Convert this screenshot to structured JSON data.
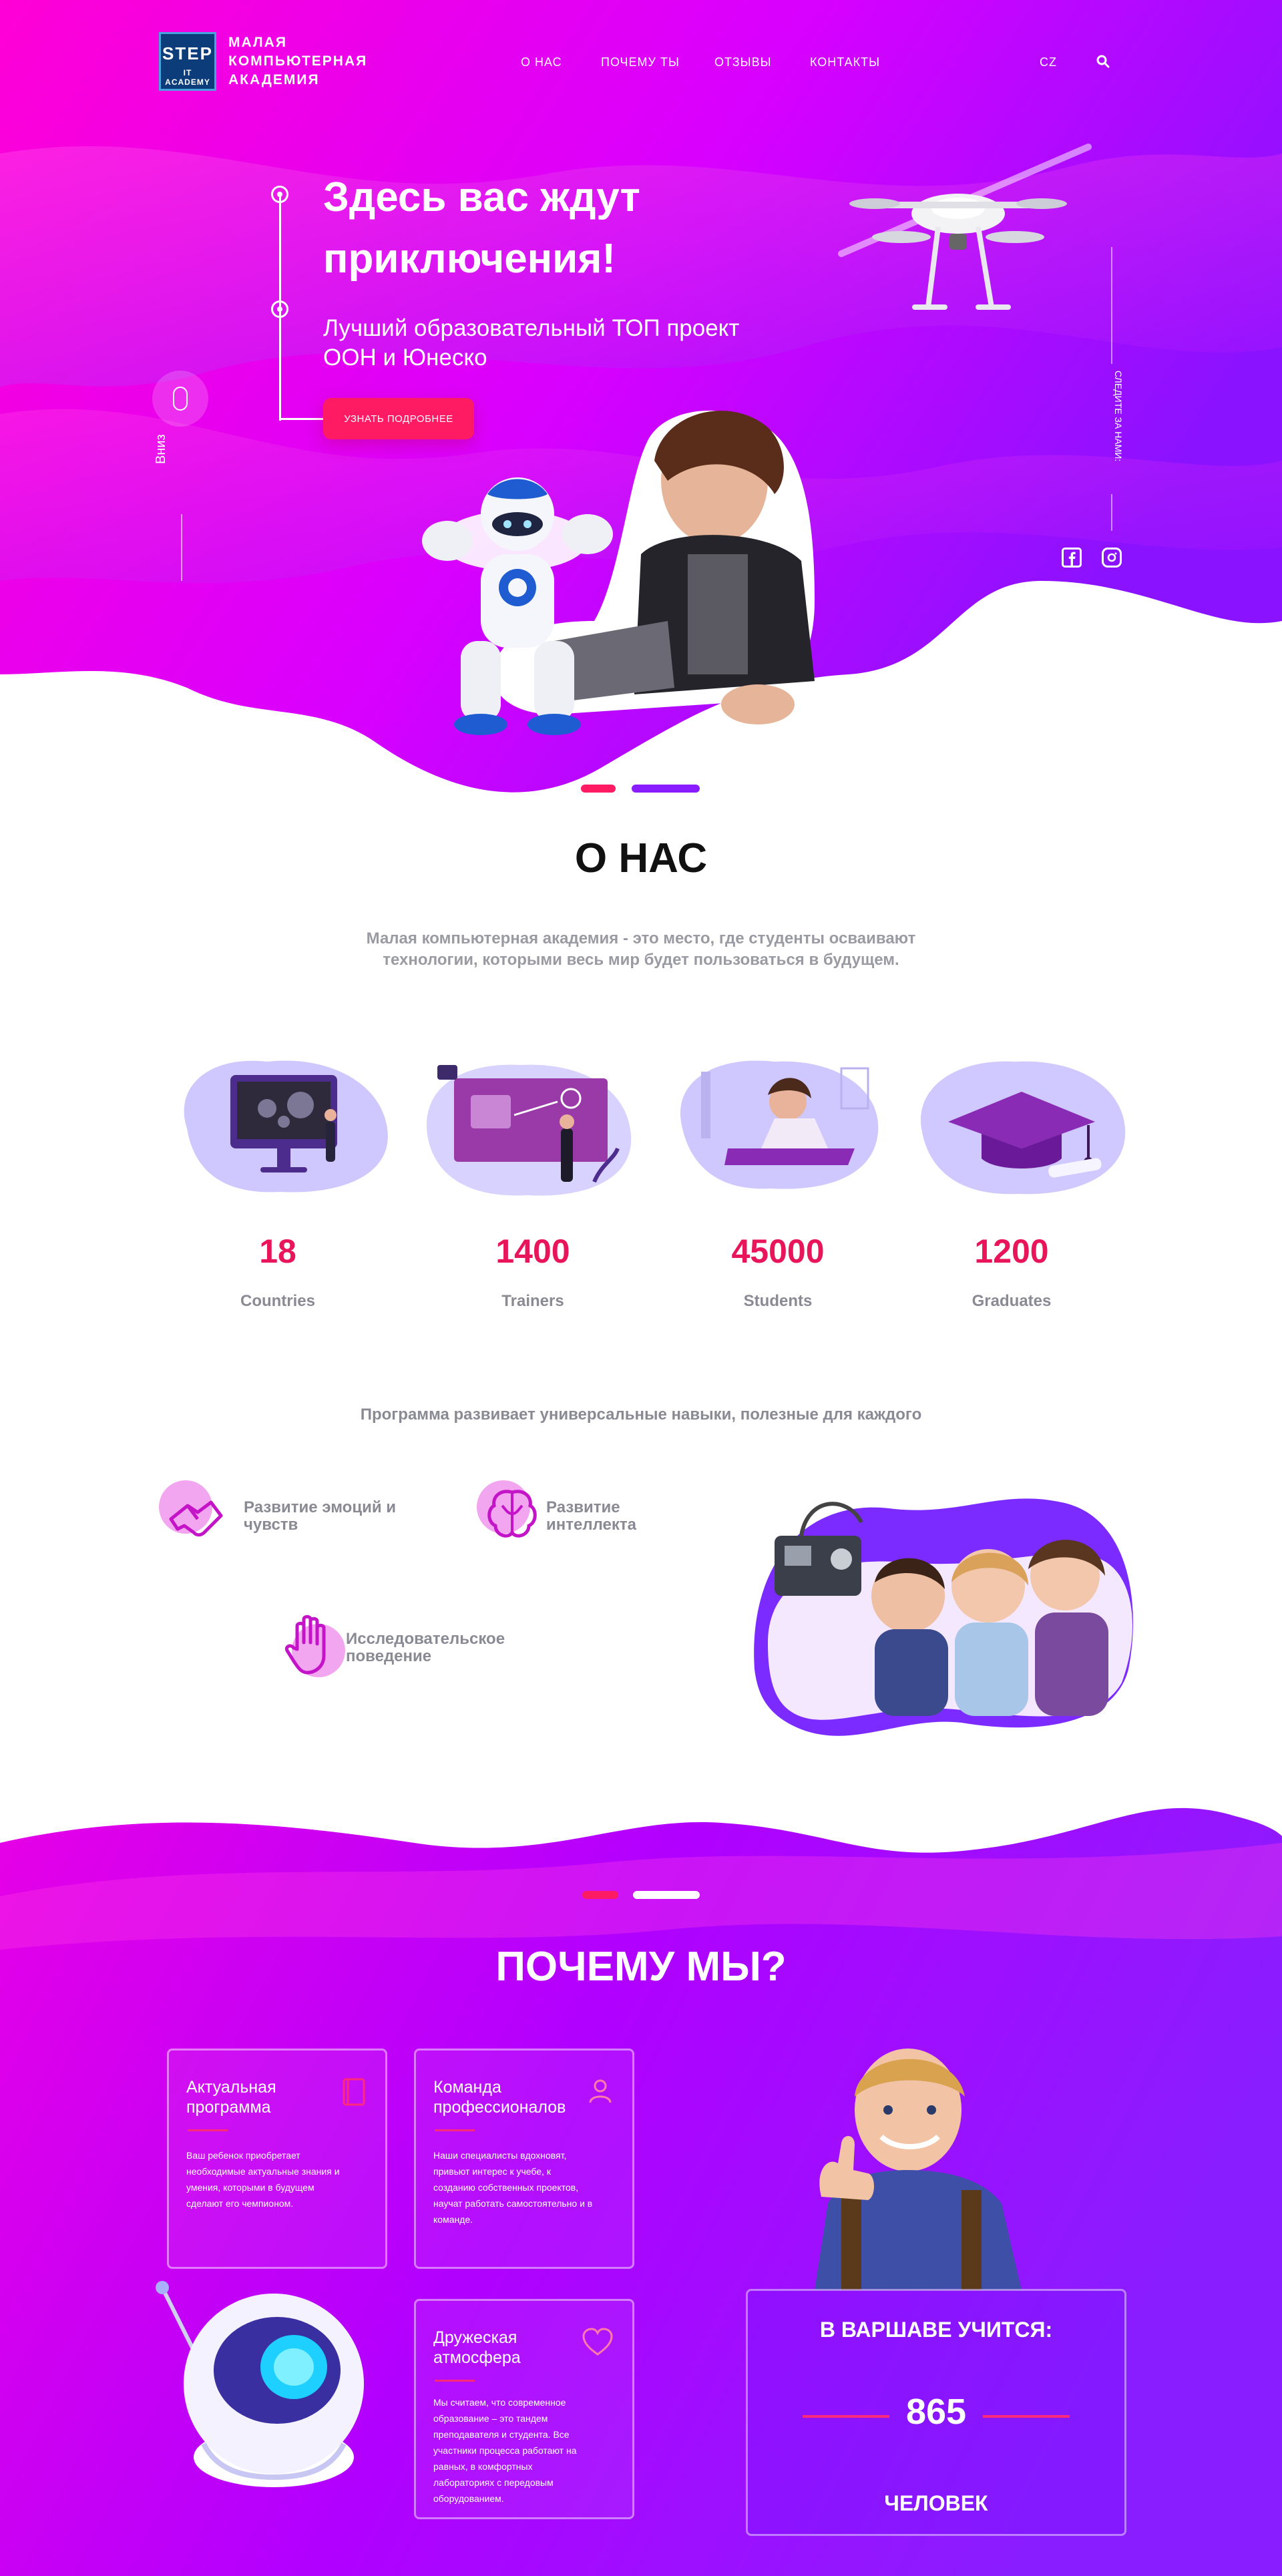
{
  "header": {
    "logo_step": "STEP",
    "logo_it": "IT ACADEMY",
    "brand_lines": [
      "МАЛАЯ",
      "КОМПЬЮТЕРНАЯ",
      "АКАДЕМИЯ"
    ],
    "nav": [
      "О НАС",
      "ПОЧЕМУ ТЫ",
      "ОТЗЫВЫ",
      "КОНТАКТЫ"
    ],
    "lang": "CZ"
  },
  "hero": {
    "title_lines": [
      "Здесь вас ждут",
      "приключения!"
    ],
    "subtitle_lines": [
      "Лучший образовательный ТОП проект",
      "ООН и Юнеско"
    ],
    "button": "УЗНАТЬ ПОДРОБНЕЕ",
    "scroll_label": "Вниз",
    "follow_label": "СЛЕДИТЕ ЗА НАМИ:"
  },
  "about": {
    "title": "О НАС",
    "desc_lines": [
      "Малая компьютерная академия - это место, где студенты осваивают",
      "технологии, которыми весь мир будет пользоваться в будущем."
    ],
    "stats": [
      {
        "value": "18",
        "label": "Countries"
      },
      {
        "value": "1400",
        "label": "Trainers"
      },
      {
        "value": "45000",
        "label": "Students"
      },
      {
        "value": "1200",
        "label": "Graduates"
      }
    ],
    "program_text": "Программа развивает универсальные навыки, полезные для каждого",
    "skills": [
      {
        "lines": [
          "Развитие эмоций и",
          "чувств"
        ],
        "icon": "handshake-icon"
      },
      {
        "lines": [
          "Развитие",
          "интеллекта"
        ],
        "icon": "brain-icon"
      },
      {
        "lines": [
          "Исследовательское",
          "поведение"
        ],
        "icon": "hand-icon"
      }
    ]
  },
  "why": {
    "title": "ПОЧЕМУ МЫ?",
    "cards": [
      {
        "title_lines": [
          "Актуальная",
          "программа"
        ],
        "text_lines": [
          "Ваш ребенок приобретает",
          "необходимые актуальные знания и",
          "умения, которыми в будущем",
          "сделают его чемпионом."
        ],
        "icon": "book-icon"
      },
      {
        "title_lines": [
          "Команда",
          "профессионалов"
        ],
        "text_lines": [
          "Наши специалисты вдохновят,",
          "привьют интерес к учебе, к",
          "созданию собственных проектов,",
          "научат работать самостоятельно и в",
          "команде."
        ],
        "icon": "user-icon"
      },
      {
        "title_lines": [
          "Дружеская",
          "атмосфера"
        ],
        "text_lines": [
          "Мы считаем, что современное",
          "образование – это тандем",
          "преподавателя и студента. Все",
          "участники процесса работают на",
          "равных, в комфортных",
          "лабораториях с передовым",
          "оборудованием."
        ],
        "icon": "heart-icon"
      }
    ],
    "warsaw": {
      "title": "В ВАРШАВЕ УЧИТСЯ:",
      "number": "865",
      "footer": "ЧЕЛОВЕК"
    }
  },
  "colors": {
    "accent": "#ff1a64",
    "stat": "#e8155b",
    "purple": "#8a1dff",
    "magenta": "#ff00d4",
    "grey_text": "#9a9aa3"
  }
}
